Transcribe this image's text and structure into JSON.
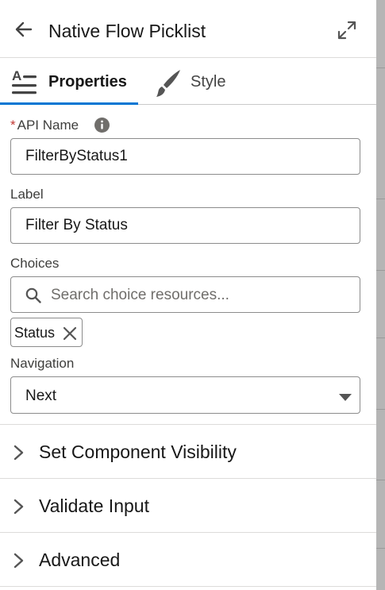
{
  "header": {
    "title": "Native Flow Picklist"
  },
  "tabs": [
    {
      "label": "Properties",
      "icon": "text-lines-icon",
      "active": true
    },
    {
      "label": "Style",
      "icon": "brush-icon",
      "active": false
    }
  ],
  "form": {
    "api_name": {
      "required_mark": "*",
      "label": "API Name",
      "value": "FilterByStatus1"
    },
    "label_field": {
      "label": "Label",
      "value": "Filter By Status"
    },
    "choices": {
      "label": "Choices",
      "placeholder": "Search choice resources...",
      "selected": [
        "Status"
      ]
    },
    "navigation": {
      "label": "Navigation",
      "value": "Next"
    }
  },
  "sections": [
    {
      "title": "Set Component Visibility"
    },
    {
      "title": "Validate Input"
    },
    {
      "title": "Advanced"
    }
  ],
  "colors": {
    "accent": "#0176d3",
    "border": "#8c8c8c",
    "divider": "#dddbda",
    "required": "#c23934"
  }
}
